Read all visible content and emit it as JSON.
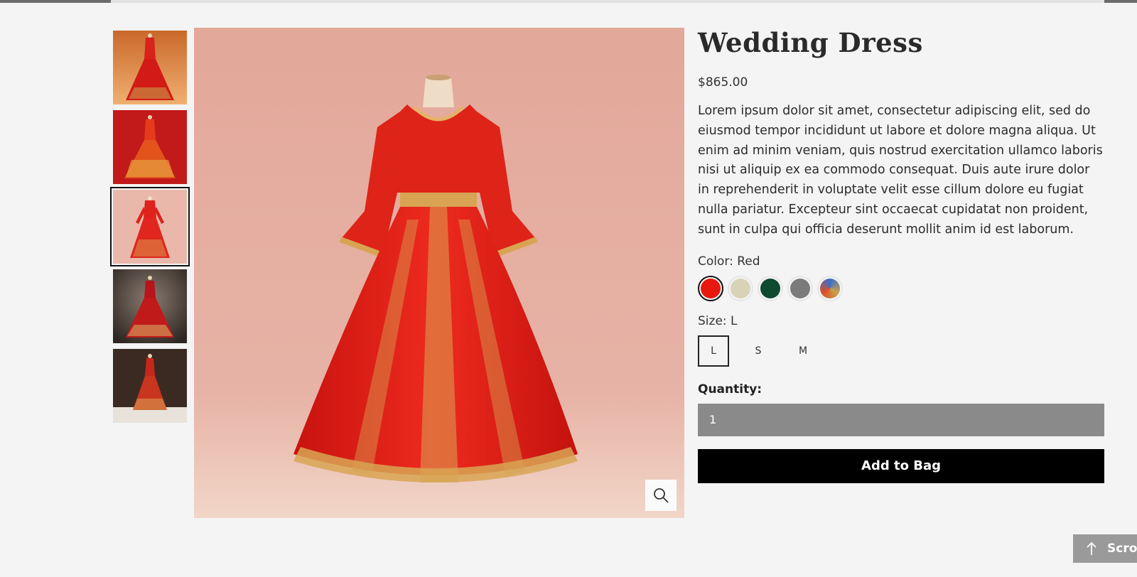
{
  "product": {
    "title": "Wedding Dress",
    "price": "$865.00",
    "description": "Lorem ipsum dolor sit amet, consectetur adipiscing elit, sed do eiusmod tempor incididunt ut labore et dolore magna aliqua. Ut enim ad minim veniam, quis nostrud exercitation ullamco laboris nisi ut aliquip ex ea commodo consequat. Duis aute irure dolor in reprehenderit in voluptate velit esse cillum dolore eu fugiat nulla pariatur. Excepteur sint occaecat cupidatat non proident, sunt in culpa qui officia deserunt mollit anim id est laborum."
  },
  "color": {
    "label": "Color: Red",
    "swatches": [
      {
        "name": "red",
        "hex": "#e8170f",
        "selected": true
      },
      {
        "name": "beige",
        "hex": "#d8d2b6",
        "selected": false
      },
      {
        "name": "dark-green",
        "hex": "#0f4a30",
        "selected": false
      },
      {
        "name": "gray",
        "hex": "#7b7b7b",
        "selected": false
      },
      {
        "name": "multicolor",
        "hex": "#c9a24a",
        "selected": false
      }
    ]
  },
  "size": {
    "label": "Size: L",
    "options": [
      {
        "label": "L",
        "selected": true
      },
      {
        "label": "S",
        "selected": false
      },
      {
        "label": "M",
        "selected": false
      }
    ]
  },
  "quantity": {
    "label": "Quantity:",
    "value": "1"
  },
  "actions": {
    "add_to_bag": "Add to Bag",
    "scroll_top": "Scro"
  },
  "gallery": {
    "selected_index": 2,
    "thumbnails": [
      {
        "bg": "#d98a4a"
      },
      {
        "bg": "#c81e1e"
      },
      {
        "bg": "#e3b0a0"
      },
      {
        "bg": "#4a403a"
      },
      {
        "bg": "#3a2a24"
      }
    ]
  },
  "icons": {
    "zoom": "magnifier-icon",
    "scroll_top": "arrow-up-icon"
  }
}
